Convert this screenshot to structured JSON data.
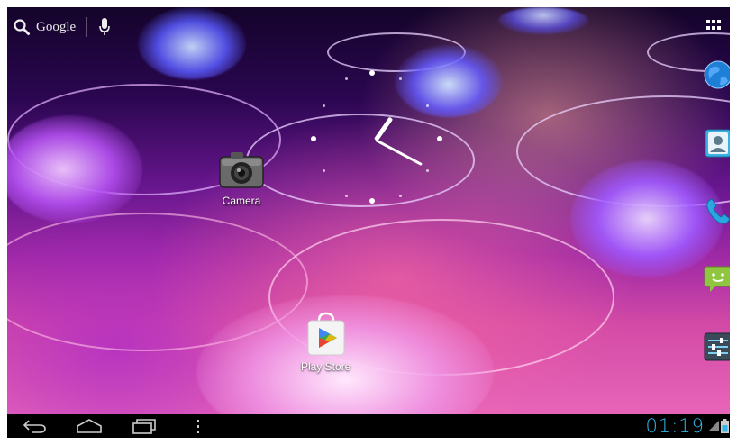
{
  "search": {
    "label": "Google",
    "search_icon": "search-icon",
    "voice_icon": "microphone-icon"
  },
  "apps_button": {
    "icon": "all-apps-grid-icon"
  },
  "clock_widget": {
    "icon": "analog-clock"
  },
  "desktop_icons": [
    {
      "label": "Camera",
      "icon": "camera-icon"
    },
    {
      "label": "Play Store",
      "icon": "play-store-icon"
    }
  ],
  "dock": [
    {
      "icon": "browser-globe-icon"
    },
    {
      "icon": "contacts-icon"
    },
    {
      "icon": "phone-icon"
    },
    {
      "icon": "messaging-icon"
    },
    {
      "icon": "settings-icon"
    }
  ],
  "navbar": {
    "back_icon": "back-icon",
    "home_icon": "home-icon",
    "recents_icon": "recent-apps-icon",
    "menu_icon": "menu-icon",
    "time": "01:19",
    "signal_icon": "signal-icon",
    "battery_icon": "battery-icon",
    "time_color": "#33b5e5"
  }
}
